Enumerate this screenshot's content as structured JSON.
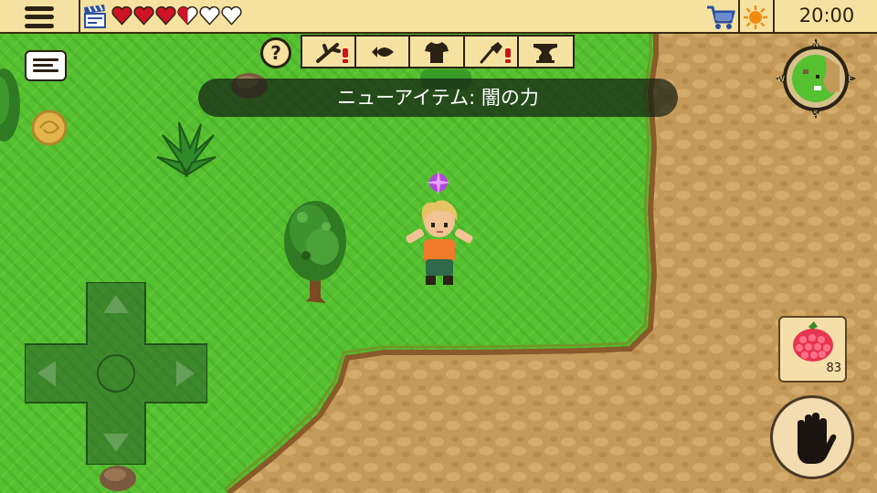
{
  "hud": {
    "time": "20:00",
    "health": {
      "full_hearts": 3,
      "half_hearts": 1,
      "empty_hearts": 2,
      "max_hearts": 6
    },
    "colors": {
      "bar_bg": "#f6e2a0",
      "heart": "#d01428",
      "accent_red": "#c8141e"
    }
  },
  "icons": {
    "menu": "hamburger-menu-icon",
    "record": "clapperboard-icon",
    "shop": "shopping-cart-icon",
    "daytime": "sun-icon",
    "help": "question-icon",
    "chat": "chat-message-icon",
    "minimap": "compass-minimap-icon",
    "dpad": "directional-pad-icon",
    "hand": "hand-icon"
  },
  "help_button": {
    "label": "?"
  },
  "toolbar": {
    "slots": [
      {
        "icon": "branch-tool-icon",
        "alert": true
      },
      {
        "icon": "fish-icon",
        "alert": false
      },
      {
        "icon": "shirt-icon",
        "alert": false
      },
      {
        "icon": "shovel-icon",
        "alert": true
      },
      {
        "icon": "anvil-icon",
        "alert": false
      }
    ]
  },
  "notification": {
    "text": "ニューアイテム: 闇の力"
  },
  "minimap": {
    "compass_letters": [
      "N",
      "E",
      "S",
      "W"
    ]
  },
  "inventory": {
    "selected_item_icon": "raspberry-icon",
    "count": "83"
  }
}
